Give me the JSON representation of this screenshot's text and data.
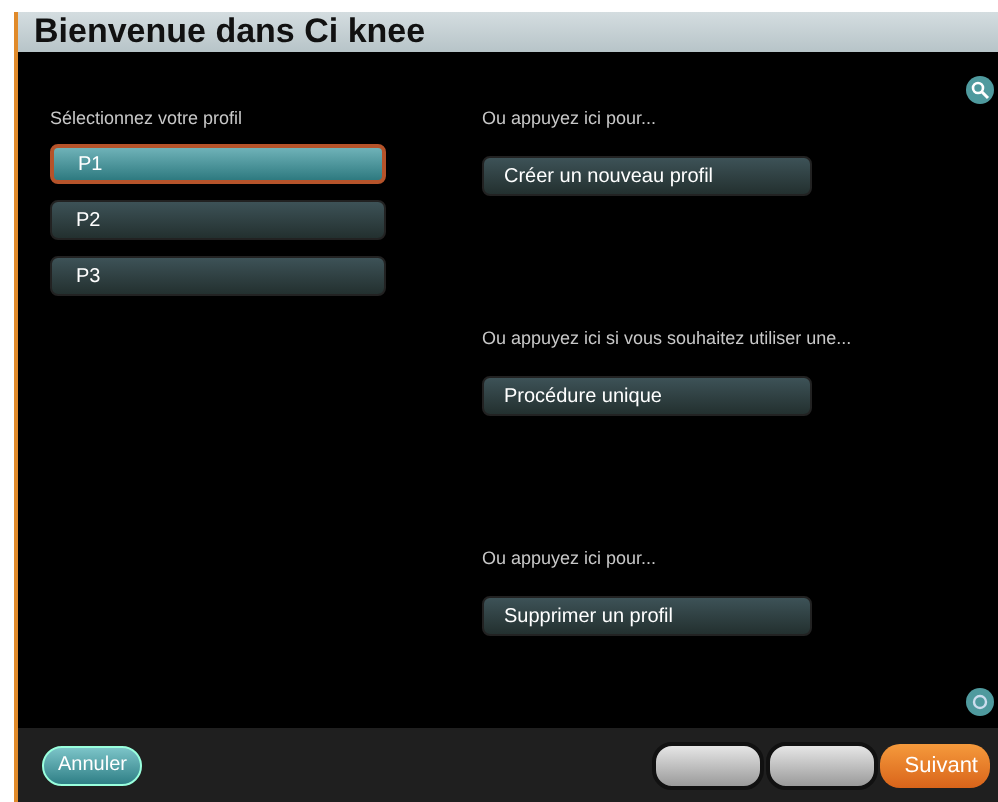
{
  "window": {
    "title": "Bienvenue dans Ci knee"
  },
  "profiles": {
    "label": "Sélectionnez votre profil",
    "items": [
      {
        "label": "P1",
        "selected": true
      },
      {
        "label": "P2",
        "selected": false
      },
      {
        "label": "P3",
        "selected": false
      }
    ]
  },
  "actions": [
    {
      "prompt": "Ou appuyez ici pour...",
      "button": "Créer un nouveau profil"
    },
    {
      "prompt": "Ou appuyez ici si vous souhaitez utiliser une...",
      "button": "Procédure unique"
    },
    {
      "prompt": "Ou appuyez ici pour...",
      "button": "Supprimer un profil"
    }
  ],
  "footer": {
    "cancel": "Annuler",
    "next": "Suivant"
  }
}
